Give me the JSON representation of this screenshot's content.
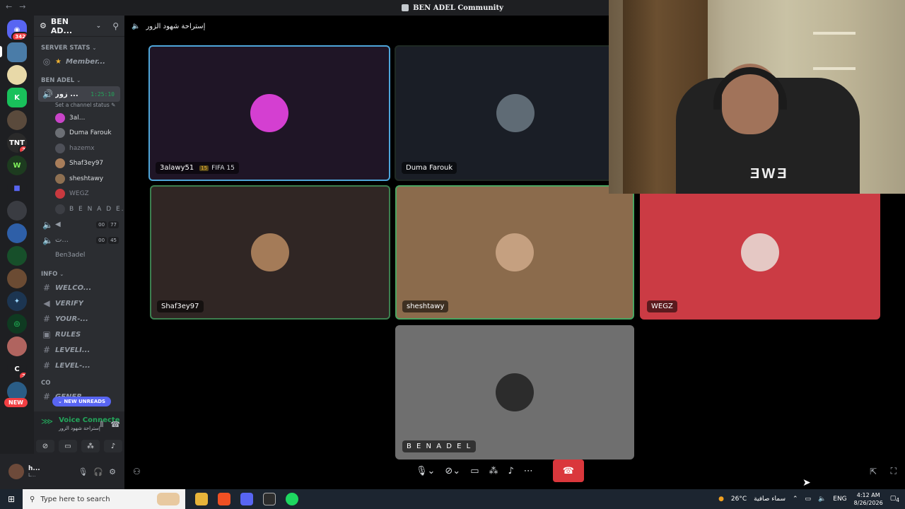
{
  "window": {
    "title": "BEN ADEL Community"
  },
  "rail": {
    "badge_home": "342",
    "badge_tnt": "2",
    "badge_c": "2",
    "new_label": "NEW"
  },
  "sidebar": {
    "guild_name": "BEN AD...",
    "stats_category": "SERVER STATS",
    "member_channel": "Member...",
    "ben_category": "BEN ADEL",
    "voice_channel": "زور ...",
    "voice_timer": "1:25:10",
    "set_status": "Set a channel status",
    "members": [
      {
        "name": "3al...",
        "avatar": "#c944c8",
        "muted": false
      },
      {
        "name": "Duma Farouk",
        "avatar": "#6c6f75",
        "muted": false
      },
      {
        "name": "hazemx",
        "avatar": "#4e5058",
        "muted": true
      },
      {
        "name": "Shaf3ey97",
        "avatar": "#a87d5a",
        "muted": false
      },
      {
        "name": "sheshtawy",
        "avatar": "#8e7052",
        "muted": false
      },
      {
        "name": "WEGZ",
        "avatar": "#c8393f",
        "muted": true
      },
      {
        "name": "B E N A D E...",
        "avatar": "#3c3e44",
        "muted": true
      }
    ],
    "voice2_counts": [
      "00",
      "77"
    ],
    "voice3_name": "ت...",
    "voice3_counts": [
      "00",
      "45"
    ],
    "ben3adel": "Ben3adel",
    "info_category": "INFO",
    "info_channels": [
      {
        "icon": "#",
        "name": "WELCO..."
      },
      {
        "icon": "◀",
        "name": "VERIFY"
      },
      {
        "icon": "#",
        "name": "YOUR-..."
      },
      {
        "icon": "▣",
        "name": "RULES"
      },
      {
        "icon": "#",
        "name": "LEVELI..."
      },
      {
        "icon": "#",
        "name": "LEVEL-..."
      }
    ],
    "com_category": "CO",
    "new_unreads": "NEW UNREADS",
    "general_channel": "GENER..."
  },
  "voice_panel": {
    "status": "Voice Connecte",
    "subtitle": "إستراحة شهود الزور"
  },
  "user_panel": {
    "name": "h...",
    "status": "L..."
  },
  "stage": {
    "channel_title": "إستراحة شهود الزور"
  },
  "tiles": [
    {
      "name": "3alawy51",
      "game": "FIFA 15",
      "game_icon": "15",
      "bg": "#1f1526",
      "avatar": "#d43fd1",
      "border": "#4ea5d9"
    },
    {
      "name": "Duma Farouk",
      "bg": "#1a1e26",
      "avatar": "#5f6b75",
      "border": "#1f2a24"
    },
    {
      "name": "Shaf3ey97",
      "bg": "#302624",
      "avatar": "#a47b58",
      "border": "#3c7f4f"
    },
    {
      "name": "sheshtawy",
      "bg": "#8b6b4c",
      "avatar": "#c5a080",
      "border": "#4aa561"
    },
    {
      "name": "WEGZ",
      "bg": "#cb3b44",
      "avatar": "#e5c8c4",
      "border": "#cb3b44"
    },
    {
      "name": "B E N A D E L",
      "bg": "#6f6f6f",
      "avatar": "#2c2c2c",
      "border": "#6f6f6f"
    }
  ],
  "webcam": {
    "shirt_text": "ƎWƎ"
  },
  "taskbar": {
    "search_placeholder": "Type here to search",
    "weather": "26°C",
    "weather_desc": "سماء صافية",
    "lang": "ENG",
    "time": "4:12 AM",
    "date": "8/26/2026",
    "notif": "4"
  }
}
